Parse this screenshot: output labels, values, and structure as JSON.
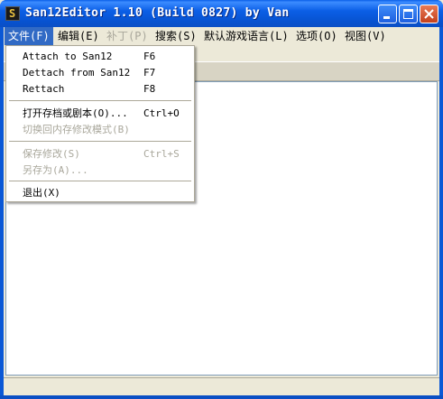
{
  "window": {
    "title": "San12Editor 1.10 (Build 0827) by Van",
    "icon": "app-icon",
    "icon_glyph": "S"
  },
  "menubar": {
    "items": [
      {
        "label": "文件(F)",
        "active": true,
        "disabled": false
      },
      {
        "label": "编辑(E)",
        "active": false,
        "disabled": false
      },
      {
        "label": "补丁(P)",
        "active": false,
        "disabled": true
      },
      {
        "label": "搜索(S)",
        "active": false,
        "disabled": false
      },
      {
        "label": "默认游戏语言(L)",
        "active": false,
        "disabled": false
      },
      {
        "label": "选项(O)",
        "active": false,
        "disabled": false
      },
      {
        "label": "视图(V)",
        "active": false,
        "disabled": false
      }
    ]
  },
  "file_menu": {
    "items": [
      {
        "label": "Attach to San12",
        "shortcut": "F6",
        "disabled": false
      },
      {
        "label": "Dettach from San12",
        "shortcut": "F7",
        "disabled": false
      },
      {
        "label": "Rettach",
        "shortcut": "F8",
        "disabled": false
      },
      {
        "label": "打开存档或剧本(O)...",
        "shortcut": "Ctrl+O",
        "disabled": false
      },
      {
        "label": "切换回内存修改模式(B)",
        "shortcut": "",
        "disabled": true
      },
      {
        "label": "保存修改(S)",
        "shortcut": "Ctrl+S",
        "disabled": true
      },
      {
        "label": "另存为(A)...",
        "shortcut": "",
        "disabled": true
      },
      {
        "label": "退出(X)",
        "shortcut": "",
        "disabled": false
      }
    ]
  },
  "colors": {
    "titlebar": "#0a58d6",
    "menu_highlight": "#316ac5",
    "disabled_text": "#a9a79b"
  }
}
